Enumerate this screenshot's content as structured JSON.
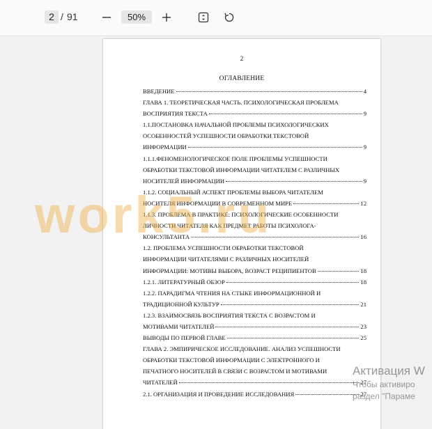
{
  "toolbar": {
    "current_page": "2",
    "separator": "/",
    "total_pages": "91",
    "zoom": "50%",
    "zoom_out_icon": "minus-icon",
    "zoom_in_icon": "plus-icon",
    "fit_icon": "fit-page-icon",
    "rotate_icon": "rotate-icon"
  },
  "document": {
    "page_number": "2",
    "toc_title": "ОГЛАВЛЕНИЕ",
    "entries": [
      {
        "lines": [
          "ВВЕДЕНИЕ"
        ],
        "page": "4"
      },
      {
        "lines": [
          "ГЛАВА 1. ТЕОРЕТИЧЕСКАЯ ЧАСТЬ. ПСИХОЛОГИЧЕСКАЯ ПРОБЛЕМА",
          "ВОСПРИЯТИЯ ТЕКСТА"
        ],
        "page": "9"
      },
      {
        "lines": [
          "1.1.ПОСТАНОВКА НАЧАЛЬНОЙ ПРОБЛЕМЫ ПСИХОЛОГИЧЕСКИХ",
          "ОСОБЕННОСТЕЙ УСПЕШНОСТИ ОБРАБОТКИ ТЕКСТОВОЙ",
          "ИНФОРМАЦИИ"
        ],
        "page": "9"
      },
      {
        "lines": [
          "1.1.1.ФЕНОМЕНОЛОГИЧЕСКОЕ ПОЛЕ ПРОБЛЕМЫ УСПЕШНОСТИ",
          "ОБРАБОТКИ ТЕКСТОВОЙ ИНФОРМАЦИИ ЧИТАТЕЛЕМ С РАЗЛИЧНЫХ",
          "НОСИТЕЛЕЙ ИНФОРМАЦИИ"
        ],
        "page": "9"
      },
      {
        "lines": [
          "1.1.2. СОЦИАЛЬНЫЙ АСПЕКТ ПРОБЛЕМЫ ВЫБОРА ЧИТАТЕЛЕМ",
          "НОСИТЕЛЯ ИНФОРМАЦИИ В СОВРЕМЕННОМ МИРЕ"
        ],
        "page": "12"
      },
      {
        "lines": [
          "1.1.3. ПРОБЛЕМА В ПРАКТИКЕ: ПСИХОЛОГИЧЕСКИЕ ОСОБЕННОСТИ",
          "ЛИЧНОСТИ ЧИТАТЕЛЯ КАК ПРЕДМЕТ РАБОТЫ ПСИХОЛОГА-",
          "КОНСУЛЬТАНТА"
        ],
        "page": "16"
      },
      {
        "lines": [
          "1.2. ПРОБЛЕМА УСПЕШНОСТИ ОБРАБОТКИ ТЕКСТОВОЙ",
          "ИНФОРМАЦИИ ЧИТАТЕЛЯМИ С РАЗЛИЧНЫХ НОСИТЕЛЕЙ",
          "ИНФОРМАЦИИ: МОТИВЫ ВЫБОРА, ВОЗРАСТ РЕЦИПИЕНТОВ"
        ],
        "page": "18"
      },
      {
        "lines": [
          "1.2.1. ЛИТЕРАТУРНЫЙ ОБЗОР"
        ],
        "page": "18"
      },
      {
        "lines": [
          "1.2.2. ПАРАДИГМА ЧТЕНИЯ НА СТЫКЕ ИНФОРМАЦИОННОЙ И",
          "ТРАДИЦИОННОЙ КУЛЬТУР"
        ],
        "page": "21"
      },
      {
        "lines": [
          "1.2.3. ВЗАИМОСВЯЗЬ ВОСПРИЯТИЯ ТЕКСТА С ВОЗРАСТОМ И",
          "МОТИВАМИ ЧИТАТЕЛЕЙ"
        ],
        "page": "23"
      },
      {
        "lines": [
          "ВЫВОДЫ ПО ПЕРВОЙ ГЛАВЕ"
        ],
        "page": "25"
      },
      {
        "lines": [
          "ГЛАВА 2. ЭМПИРИЧЕСКОЕ ИССЛЕДОВАНИЕ. АНАЛИЗ УСПЕШНОСТИ",
          "ОБРАБОТКИ ТЕКСТОВОЙ ИНФОРМАЦИИ С ЭЛЕКТРОННОГО И",
          "ПЕЧАТНОГО НОСИТЕЛЕЙ В СВЯЗИ С ВОЗРАСТОМ И МОТИВАМИ",
          "ЧИТАТЕЛЕЙ"
        ],
        "page": "27"
      },
      {
        "lines": [
          "2.1. ОРГАНИЗАЦИЯ И ПРОВЕДЕНИЕ ИССЛЕДОВАНИЯ"
        ],
        "page": "27"
      }
    ]
  },
  "watermark": {
    "text": "work5.ru",
    "color": "#f0b046"
  },
  "activation": {
    "title": "Активация W",
    "line1": "Чтобы активиро",
    "line2": "раздел \"Параме"
  }
}
